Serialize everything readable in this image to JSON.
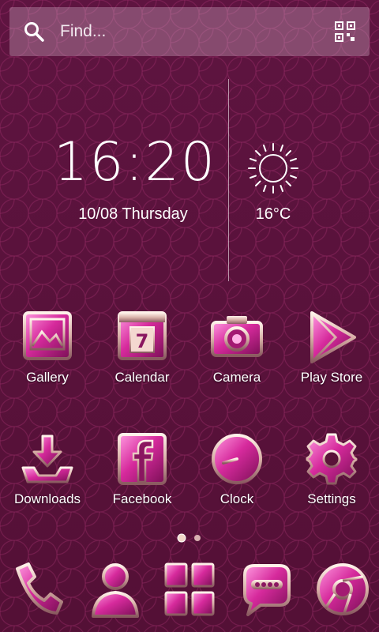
{
  "search": {
    "placeholder": "Find..."
  },
  "clock": {
    "time": "16:20",
    "date": "10/08  Thursday"
  },
  "weather": {
    "temperature": "16°C",
    "condition_icon": "sun-icon"
  },
  "apps": [
    {
      "label": "Gallery",
      "icon": "gallery-icon"
    },
    {
      "label": "Calendar",
      "icon": "calendar-icon",
      "calendar_day": "7"
    },
    {
      "label": "Camera",
      "icon": "camera-icon"
    },
    {
      "label": "Play Store",
      "icon": "play-store-icon"
    },
    {
      "label": "Downloads",
      "icon": "downloads-icon"
    },
    {
      "label": "Facebook",
      "icon": "facebook-icon"
    },
    {
      "label": "Clock",
      "icon": "clock-icon"
    },
    {
      "label": "Settings",
      "icon": "gear-icon"
    }
  ],
  "dock": [
    "phone-icon",
    "contacts-icon",
    "app-drawer-icon",
    "messages-icon",
    "browser-icon"
  ],
  "pager": {
    "pages": 2,
    "current": 1
  },
  "colors": {
    "accent": "#e040a8",
    "gem_dark": "#8a1660",
    "background": "#5a1238",
    "metal": "#e8c8c0"
  }
}
